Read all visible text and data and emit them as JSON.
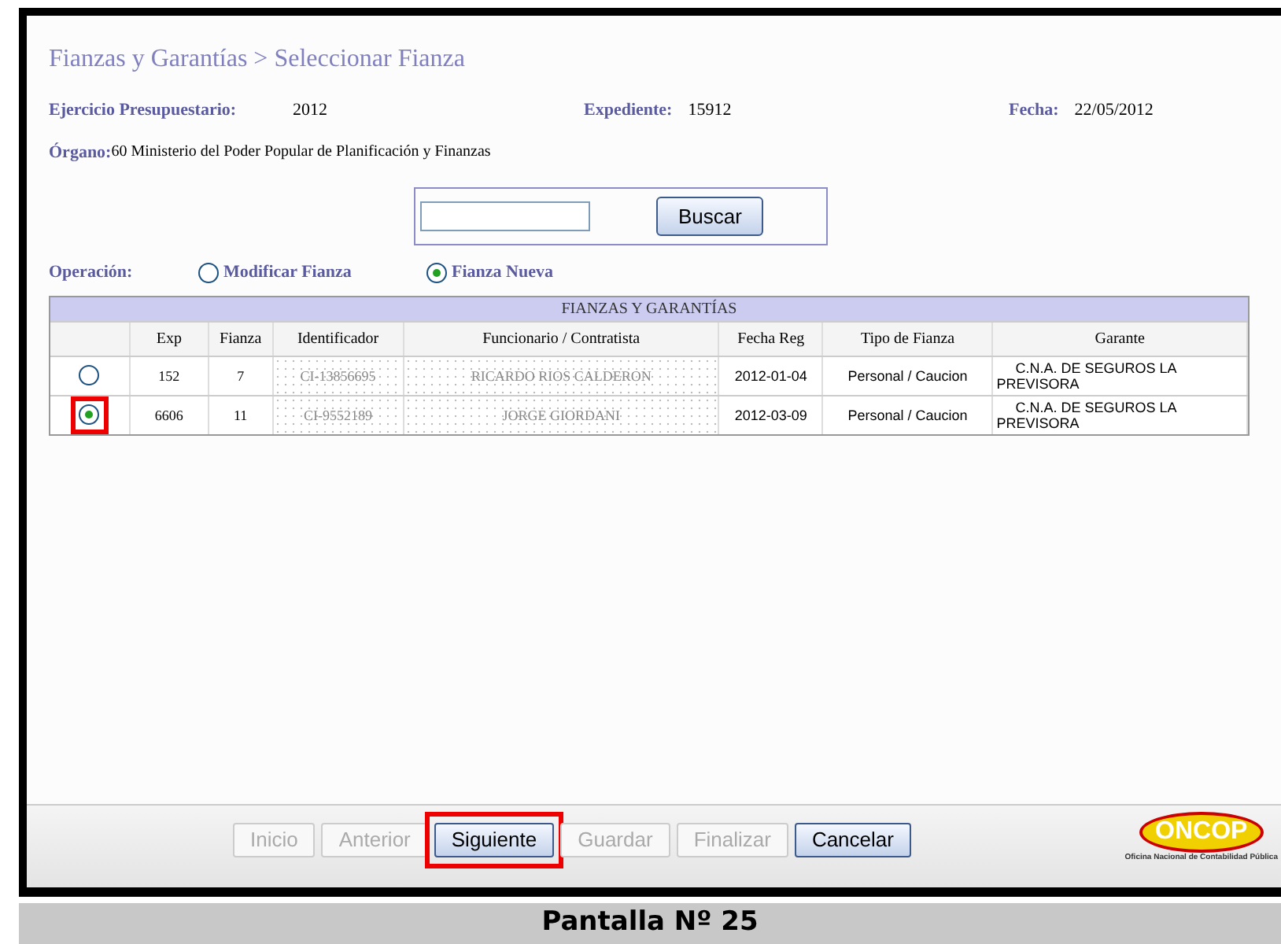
{
  "breadcrumb": "Fianzas y Garantías > Seleccionar Fianza",
  "info": [
    {
      "label": "Ejercicio Presupuestario:",
      "value": "2012"
    },
    {
      "label": "Expediente:",
      "value": "15912"
    },
    {
      "label": "Fecha:",
      "value": "22/05/2012"
    }
  ],
  "organo": {
    "label": "Órgano:",
    "value": "60 Ministerio del Poder Popular de Planificación y Finanzas"
  },
  "search": {
    "button": "Buscar"
  },
  "operation": {
    "label": "Operación:",
    "options": [
      {
        "label": "Modificar Fianza",
        "selected": false
      },
      {
        "label": "Fianza Nueva",
        "selected": true
      }
    ]
  },
  "table": {
    "title": "FIANZAS Y GARANTÍAS",
    "columns": [
      "Exp",
      "Fianza",
      "Identificador",
      "Funcionario / Contratista",
      "Fecha Reg",
      "Tipo de Fianza",
      "Garante"
    ],
    "rows": [
      {
        "selected": false,
        "highlighted": false,
        "cells": [
          "152",
          "7",
          "CI-13856695",
          "RICARDO RIOS CALDERON",
          "2012-01-04",
          "Personal / Caucion",
          "C.N.A. DE SEGUROS LA PREVISORA"
        ]
      },
      {
        "selected": true,
        "highlighted": true,
        "cells": [
          "6606",
          "11",
          "CI-9552189",
          "JORGE GIORDANI",
          "2012-03-09",
          "Personal / Caucion",
          "C.N.A. DE SEGUROS LA PREVISORA"
        ]
      }
    ]
  },
  "buttons": [
    {
      "label": "Inicio",
      "disabled": true,
      "highlighted": false
    },
    {
      "label": "Anterior",
      "disabled": true,
      "highlighted": false
    },
    {
      "label": "Siguiente",
      "disabled": false,
      "highlighted": true
    },
    {
      "label": "Guardar",
      "disabled": true,
      "highlighted": false
    },
    {
      "label": "Finalizar",
      "disabled": true,
      "highlighted": false
    },
    {
      "label": "Cancelar",
      "disabled": false,
      "highlighted": false
    }
  ],
  "logo": {
    "name": "ONCOP",
    "caption": "Oficina Nacional de Contabilidad Pública"
  },
  "caption": "Pantalla Nº 25"
}
